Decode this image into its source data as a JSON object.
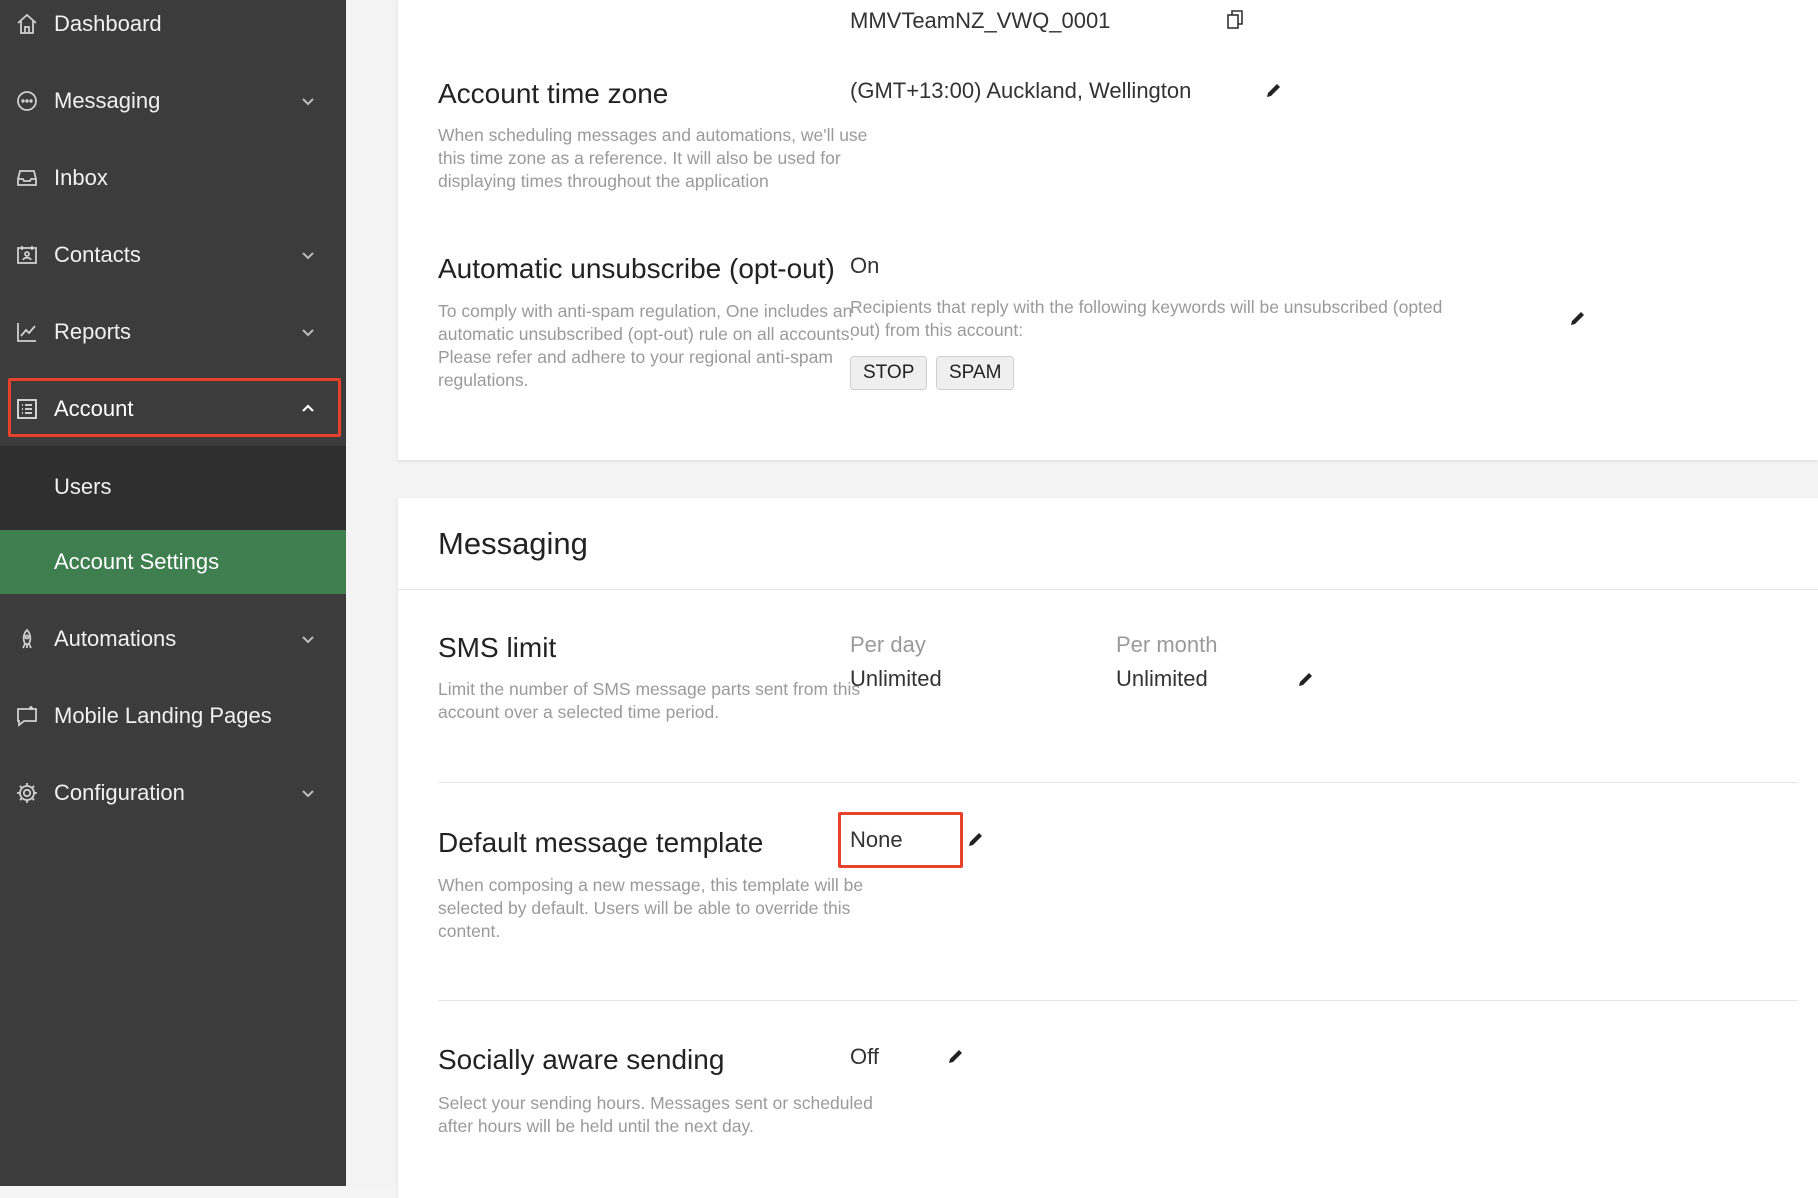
{
  "sidebar": {
    "items": [
      {
        "label": "Dashboard",
        "icon": "home-icon"
      },
      {
        "label": "Messaging",
        "icon": "chat-icon"
      },
      {
        "label": "Inbox",
        "icon": "inbox-icon"
      },
      {
        "label": "Contacts",
        "icon": "contacts-icon"
      },
      {
        "label": "Reports",
        "icon": "chart-icon"
      },
      {
        "label": "Account",
        "icon": "list-icon"
      },
      {
        "label": "Automations",
        "icon": "rocket-icon"
      },
      {
        "label": "Mobile Landing Pages",
        "icon": "landing-page-icon"
      },
      {
        "label": "Configuration",
        "icon": "gear-icon"
      }
    ],
    "sub_items": [
      {
        "label": "Users"
      },
      {
        "label": "Account Settings"
      }
    ],
    "active_color": "#3f7f4f",
    "highlight_color": "#e8412c"
  },
  "account": {
    "account_id": "MMVTeamNZ_VWQ_0001",
    "timezone": {
      "title": "Account time zone",
      "description": "When scheduling messages and automations, we'll use this time zone as a reference. It will also be used for displaying times throughout the application",
      "value": "(GMT+13:00) Auckland, Wellington"
    },
    "unsubscribe": {
      "title": "Automatic unsubscribe (opt-out)",
      "description": "To comply with anti-spam regulation, One includes an automatic unsubscribed (opt-out) rule on all accounts. Please refer and adhere to your regional anti-spam regulations.",
      "status": "On",
      "keywords_note": "Recipients that reply with the following keywords will be unsubscribed (opted out) from this account:",
      "keywords": [
        "STOP",
        "SPAM"
      ]
    }
  },
  "messaging": {
    "title": "Messaging",
    "sms_limit": {
      "title": "SMS limit",
      "description": "Limit the number of SMS message parts sent from this account over a selected time period.",
      "per_day_label": "Per day",
      "per_day_value": "Unlimited",
      "per_month_label": "Per month",
      "per_month_value": "Unlimited"
    },
    "default_template": {
      "title": "Default message template",
      "description": "When composing a new message, this template will be selected by default. Users will be able to override this content.",
      "value": "None"
    },
    "socially_aware": {
      "title": "Socially aware sending",
      "description": "Select your sending hours. Messages sent or scheduled after hours will be held until the next day.",
      "value": "Off"
    }
  }
}
